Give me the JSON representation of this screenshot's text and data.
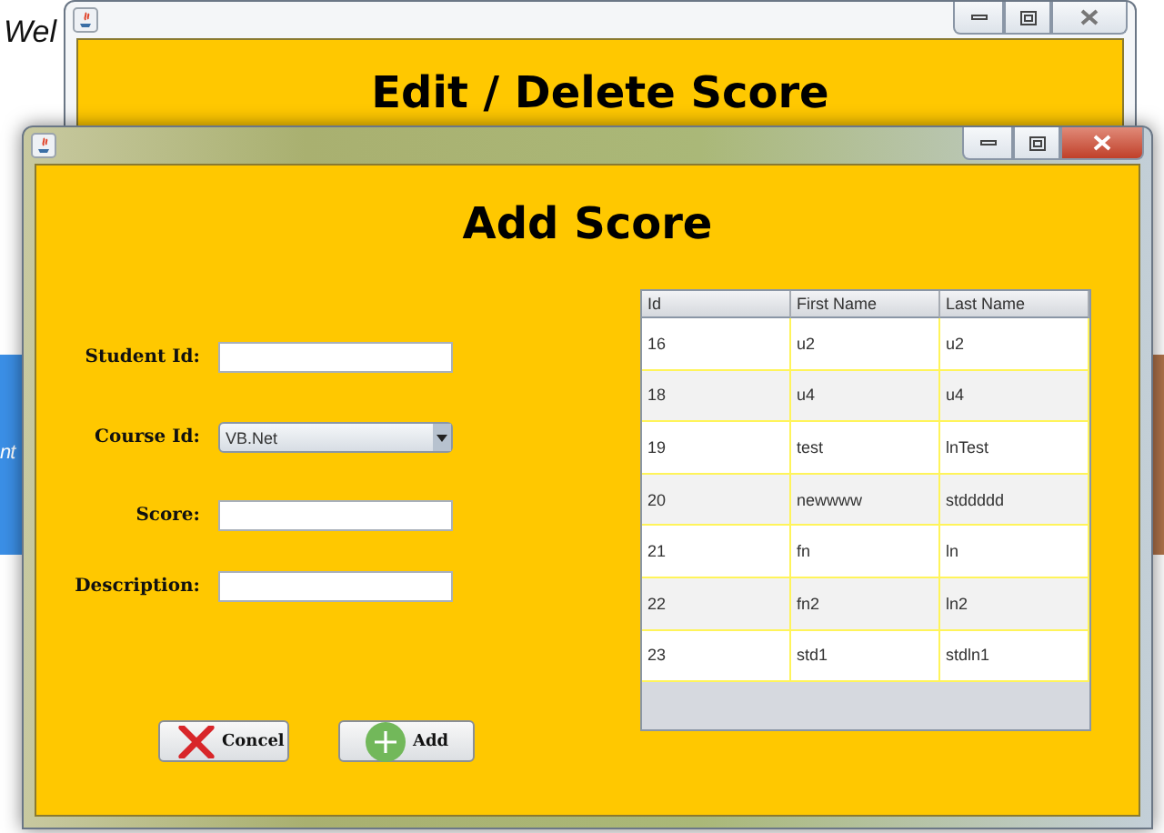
{
  "background_page": {
    "welcome_text": "Wel",
    "banner_text": "nt"
  },
  "back_window": {
    "heading": "Edit / Delete Score"
  },
  "window": {
    "heading": "Add Score"
  },
  "form": {
    "fields": [
      {
        "label": "Student Id:",
        "kind": "text"
      },
      {
        "label": "Course Id:",
        "kind": "select",
        "value": "VB.Net"
      },
      {
        "label": "Score:",
        "kind": "text"
      },
      {
        "label": "Description:",
        "kind": "text"
      }
    ]
  },
  "buttons": [
    {
      "label": "Concel",
      "kind": "cancel"
    },
    {
      "label": "Add",
      "kind": "add"
    }
  ],
  "table": {
    "columns": [
      "Id",
      "First Name",
      "Last Name"
    ],
    "rows": [
      [
        "16",
        "u2",
        "u2"
      ],
      [
        "18",
        "u4",
        "u4"
      ],
      [
        "19",
        "test",
        "lnTest"
      ],
      [
        "20",
        "newwww",
        "stddddd"
      ],
      [
        "21",
        "fn",
        "ln"
      ],
      [
        "22",
        "fn2",
        "ln2"
      ],
      [
        "23",
        "std1",
        "stdln1"
      ]
    ]
  }
}
